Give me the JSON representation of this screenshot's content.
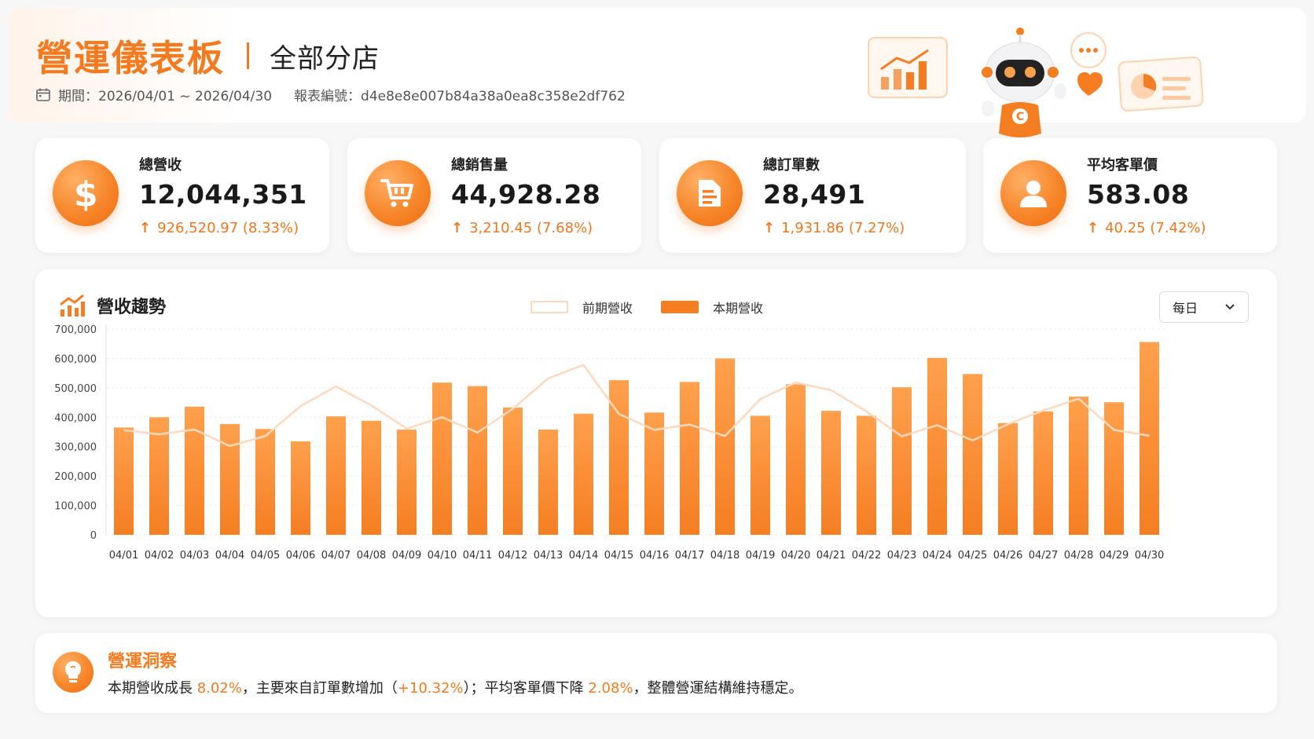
{
  "header": {
    "title": "營運儀表板",
    "subtitle": "全部分店",
    "period_label": "期間：2026/04/01 ~ 2026/04/30",
    "report_label": "報表編號：d4e8e8e007b84a38a0ea8c358e2df762"
  },
  "kpis": [
    {
      "label": "總營收",
      "value": "12,044,351",
      "delta": "926,520.97 (8.33%)",
      "icon": "dollar-icon"
    },
    {
      "label": "總銷售量",
      "value": "44,928.28",
      "delta": "3,210.45 (7.68%)",
      "icon": "cart-icon"
    },
    {
      "label": "總訂單數",
      "value": "28,491",
      "delta": "1,931.86 (7.27%)",
      "icon": "document-icon"
    },
    {
      "label": "平均客單價",
      "value": "583.08",
      "delta": "40.25 (7.42%)",
      "icon": "user-icon"
    }
  ],
  "chart": {
    "title": "營收趨勢",
    "legend_prev": "前期營收",
    "legend_cur": "本期營收",
    "select_value": "每日"
  },
  "chart_data": {
    "type": "bar",
    "categories": [
      "04/01",
      "04/02",
      "04/03",
      "04/04",
      "04/05",
      "04/06",
      "04/07",
      "04/08",
      "04/09",
      "04/10",
      "04/11",
      "04/12",
      "04/13",
      "04/14",
      "04/15",
      "04/16",
      "04/17",
      "04/18",
      "04/19",
      "04/20",
      "04/21",
      "04/22",
      "04/23",
      "04/24",
      "04/25",
      "04/26",
      "04/27",
      "04/28",
      "04/29",
      "04/30"
    ],
    "series": [
      {
        "name": "本期營收",
        "type": "bar",
        "values": [
          365000,
          400000,
          436000,
          377000,
          360000,
          318000,
          403000,
          388000,
          358000,
          518000,
          506000,
          433000,
          358000,
          412000,
          526000,
          416000,
          520000,
          600000,
          405000,
          512000,
          422000,
          405000,
          502000,
          602000,
          547000,
          380000,
          420000,
          470000,
          451000,
          656000
        ]
      },
      {
        "name": "前期營收",
        "type": "line",
        "values": [
          356000,
          342000,
          358000,
          302000,
          336000,
          438000,
          505000,
          440000,
          361000,
          400000,
          348000,
          429000,
          532000,
          578000,
          411000,
          357000,
          375000,
          336000,
          462000,
          518000,
          492000,
          420000,
          335000,
          373000,
          321000,
          376000,
          423000,
          463000,
          357000,
          337000
        ]
      }
    ],
    "ylim": [
      0,
      700000
    ],
    "yticks": [
      "700,000",
      "600,000",
      "500,000",
      "400,000",
      "300,000",
      "200,000",
      "100,000",
      "0"
    ],
    "colors": {
      "bar": "#f57e22",
      "line": "#ffd9bd"
    }
  },
  "insight": {
    "title": "營運洞察",
    "text_1": "本期營收成長 ",
    "hl_1": "8.02%",
    "text_2": "，主要來自訂單數增加（",
    "hl_2": "+10.32%",
    "text_3": "）；平均客單價下降 ",
    "hl_3": "2.08%",
    "text_4": "，整體營運結構維持穩定。"
  }
}
